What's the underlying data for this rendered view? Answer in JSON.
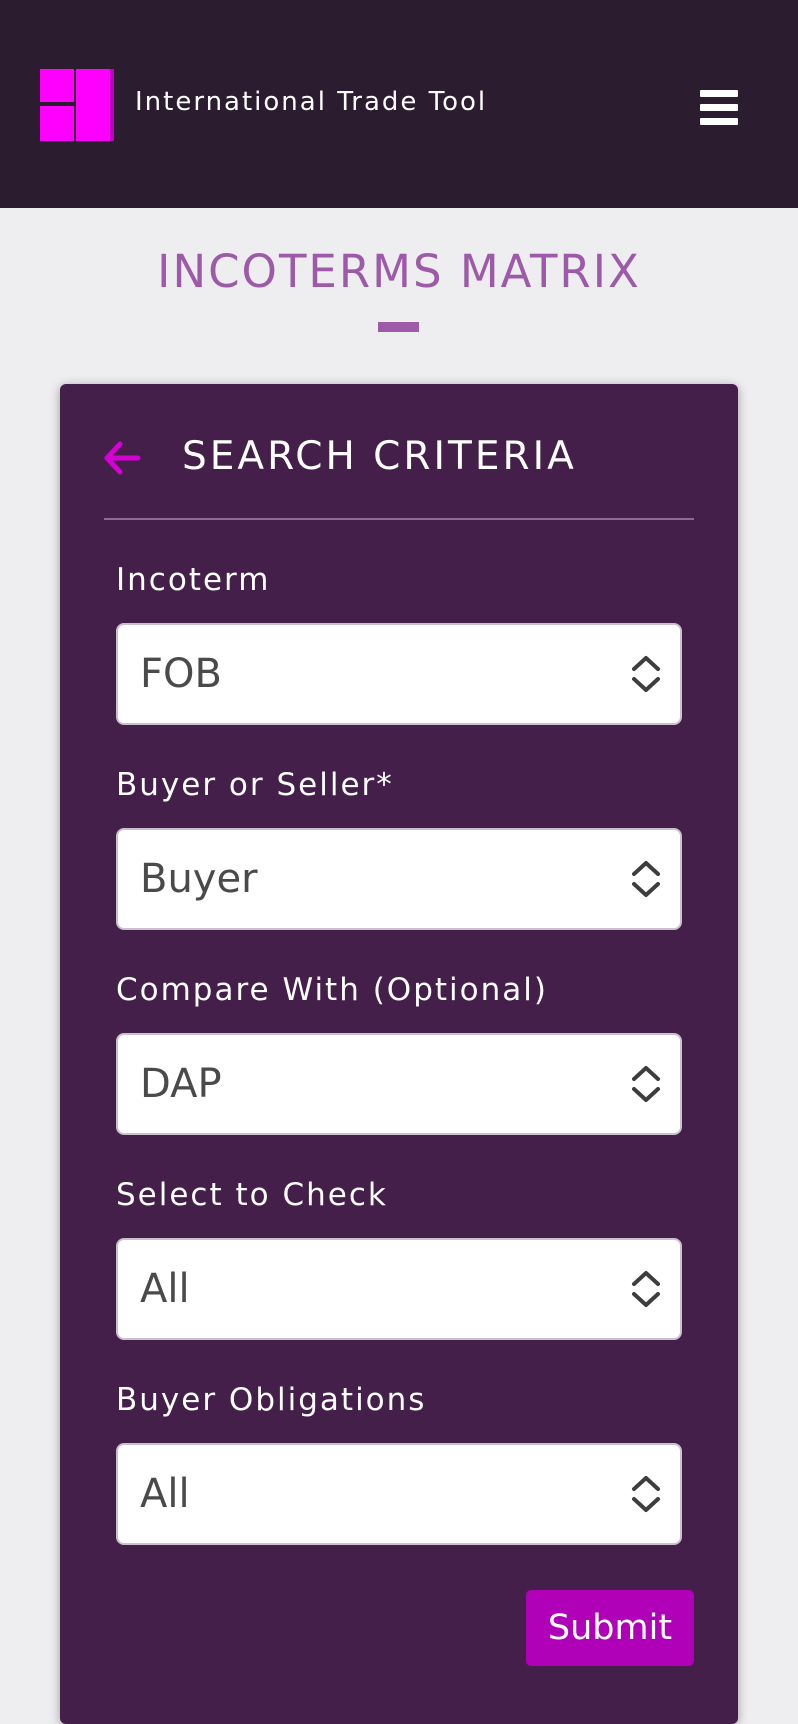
{
  "header": {
    "app_title": "International Trade Tool",
    "logo_icon": "app-logo-icon",
    "menu_icon": "hamburger-menu-icon"
  },
  "page": {
    "title": "INCOTERMS MATRIX"
  },
  "search_card": {
    "title": "SEARCH CRITERIA",
    "back_icon": "arrow-left-icon",
    "fields": [
      {
        "label": "Incoterm",
        "value": "FOB"
      },
      {
        "label": "Buyer or Seller*",
        "value": "Buyer"
      },
      {
        "label": "Compare With (Optional)",
        "value": "DAP"
      },
      {
        "label": "Select to Check",
        "value": "All"
      },
      {
        "label": "Buyer Obligations",
        "value": "All"
      }
    ],
    "submit_label": "Submit"
  },
  "colors": {
    "header_bg": "#2b1c2f",
    "page_bg": "#eeedef",
    "card_bg": "#431f4a",
    "title_purple": "#9c5aa8",
    "accent_magenta": "#b000b8",
    "logo_magenta": "#ff00ff"
  }
}
